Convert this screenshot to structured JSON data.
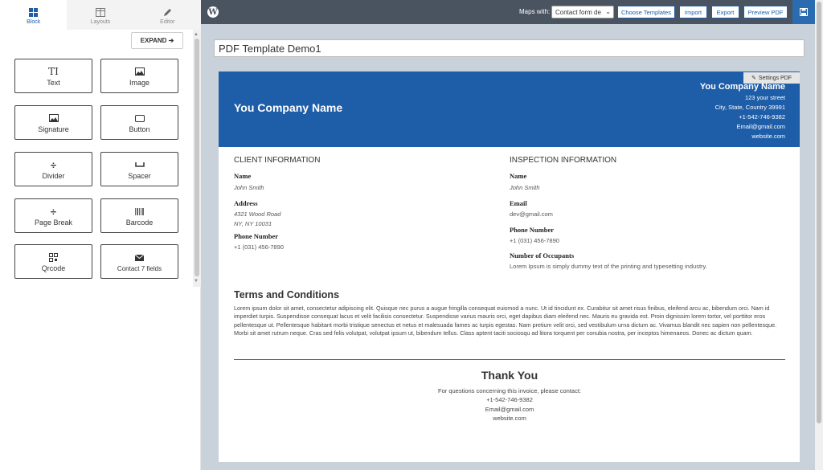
{
  "tabs": [
    {
      "label": "Block"
    },
    {
      "label": "Layouts"
    },
    {
      "label": "Editor"
    }
  ],
  "expand_label": "EXPAND ➔",
  "blocks": [
    {
      "label": "Text",
      "icon": "text-icon"
    },
    {
      "label": "Image",
      "icon": "image-icon"
    },
    {
      "label": "Signature",
      "icon": "signature-icon"
    },
    {
      "label": "Button",
      "icon": "button-icon"
    },
    {
      "label": "Divider",
      "icon": "divider-icon"
    },
    {
      "label": "Spacer",
      "icon": "spacer-icon"
    },
    {
      "label": "Page Break",
      "icon": "page-break-icon"
    },
    {
      "label": "Barcode",
      "icon": "barcode-icon"
    },
    {
      "label": "Qrcode",
      "icon": "qrcode-icon"
    },
    {
      "label": "Contact 7 fields",
      "icon": "envelope-icon"
    }
  ],
  "topbar": {
    "maps_label": "Maps with:",
    "select_value": "Contact form de",
    "choose_templates": "Choose Templates",
    "import": "Import",
    "export": "Export",
    "preview_pdf": "Preview PDF"
  },
  "template_title": "PDF Template Demo1",
  "settings_pdf": "Settings PDF",
  "header": {
    "company_name": "You Company Name",
    "right_name": "You Company Name",
    "street": "123 your street",
    "city": "City, State, Country 39991",
    "phone": "+1-542-746-9382",
    "email": "Email@gmail.com",
    "website": "website.com"
  },
  "client": {
    "heading": "CLIENT INFORMATION",
    "name_label": "Name",
    "name": "John Smith",
    "address_label": "Address",
    "address1": "4321 Wood Road",
    "address2": "NY, NY 10031",
    "phone_label": "Phone Number",
    "phone": "+1 (031) 456-7890"
  },
  "inspection": {
    "heading": "INSPECTION INFORMATION",
    "name_label": "Name",
    "name": "John Smith",
    "email_label": "Email",
    "email": "dev@gmail.com",
    "phone_label": "Phone Number",
    "phone": "+1 (031) 456-7890",
    "occupants_label": "Number of Occupants",
    "occupants": "Lorem Ipsum is simply dummy text of the printing and typesetting industry."
  },
  "terms": {
    "heading": "Terms and Conditions",
    "body": "Lorem ipsum dolor sit amet, consectetur adipiscing elit. Quisque nec purus a augue fringilla consequat euismod a nunc. Ut id tincidunt ex. Curabitur sit amet risus finibus, eleifend arcu ac, bibendum orci. Nam id imperdiet turpis. Suspendisse consequat lacus et velit facilisis consectetur. Suspendisse varius mauris orci, eget dapibus diam eleifend nec. Mauris eu gravida est. Proin dignissim lorem tortor, vel porttitor eros pellentesque ut. Pellentesque habitant morbi tristique senectus et netus et malesuada fames ac turpis egestas. Nam pretium velit orci, sed vestibulum urna dictum ac. Vivamus blandit nec sapien non pellentesque. Morbi sit amet rutrum neque. Cras sed felis volutpat, volutpat ipsum ut, bibendum tellus. Class aptent taciti sociosqu ad litora torquent per conubia nostra, per inceptos himenaeos. Donec ac dictum quam."
  },
  "footer": {
    "thank_you": "Thank You",
    "line1": "For questions concerning this invoice, please contact:",
    "phone": "+1-542-746-9382",
    "email": "Email@gmail.com",
    "website": "website.com"
  },
  "colors": {
    "brand": "#1e5da8",
    "topbar": "#4a5460",
    "canvas": "#c9d1db"
  }
}
